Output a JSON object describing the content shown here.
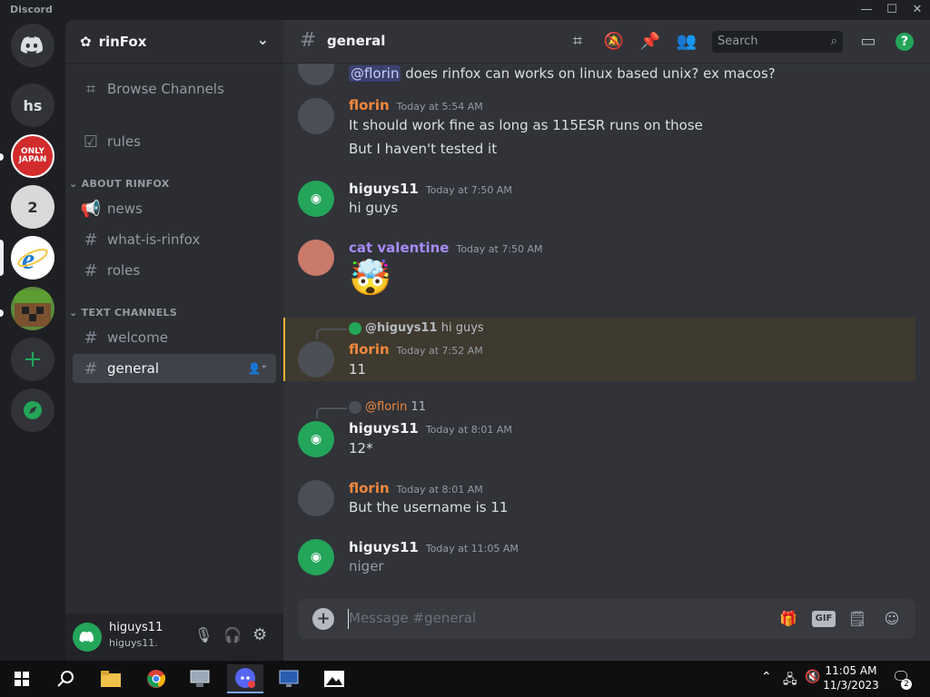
{
  "window": {
    "app_name": "Discord"
  },
  "servers": [
    {
      "label": "hs",
      "name": "hs"
    },
    {
      "label": "ONLY JAPAN",
      "name": "only-in-japan"
    },
    {
      "label": "2",
      "name": "server-2"
    }
  ],
  "guild": {
    "name": "rinFox"
  },
  "sidebar": {
    "browse": "Browse Channels",
    "rules": "rules",
    "cat_about": "ABOUT RINFOX",
    "about_channels": [
      "news",
      "what-is-rinfox",
      "roles"
    ],
    "cat_text": "TEXT CHANNELS",
    "text_channels": [
      "welcome",
      "general"
    ]
  },
  "user": {
    "display": "higuys11",
    "tag": "higuys11."
  },
  "header": {
    "channel": "general",
    "search_placeholder": "Search"
  },
  "messages": [
    {
      "body_mention": "@florin",
      "body": " does rinfox can works on linux based unix? ex macos?"
    },
    {
      "author": "florin",
      "time": "Today at 5:54 AM",
      "lines": [
        "It should work fine as long as 115ESR runs on those",
        "But I haven't tested it"
      ]
    },
    {
      "author": "higuys11",
      "time": "Today at 7:50 AM",
      "lines": [
        "hi guys"
      ]
    },
    {
      "author": "cat valentine",
      "time": "Today at 7:50 AM",
      "emoji": "🤯"
    },
    {
      "reply_to": "@higuys11",
      "reply_text": "hi guys",
      "author": "florin",
      "time": "Today at 7:52 AM",
      "lines": [
        "11"
      ]
    },
    {
      "reply_to": "@florin",
      "reply_text": "11",
      "author": "higuys11",
      "time": "Today at 8:01 AM",
      "lines": [
        "12*"
      ]
    },
    {
      "author": "florin",
      "time": "Today at 8:01 AM",
      "lines": [
        "But the username is 11"
      ]
    },
    {
      "author": "higuys11",
      "time": "Today at 11:05 AM",
      "lines": [
        "niger"
      ]
    }
  ],
  "composer": {
    "placeholder": "Message #general",
    "gif": "GIF"
  },
  "taskbar": {
    "time": "11:05 AM",
    "date": "11/3/2023",
    "notif_count": "2"
  },
  "colors": {
    "florin": "#f0883e",
    "higuys11": "#f2f3f5",
    "cat": "#a78bfa",
    "accent": "#5865f2",
    "green": "#23a55a"
  }
}
